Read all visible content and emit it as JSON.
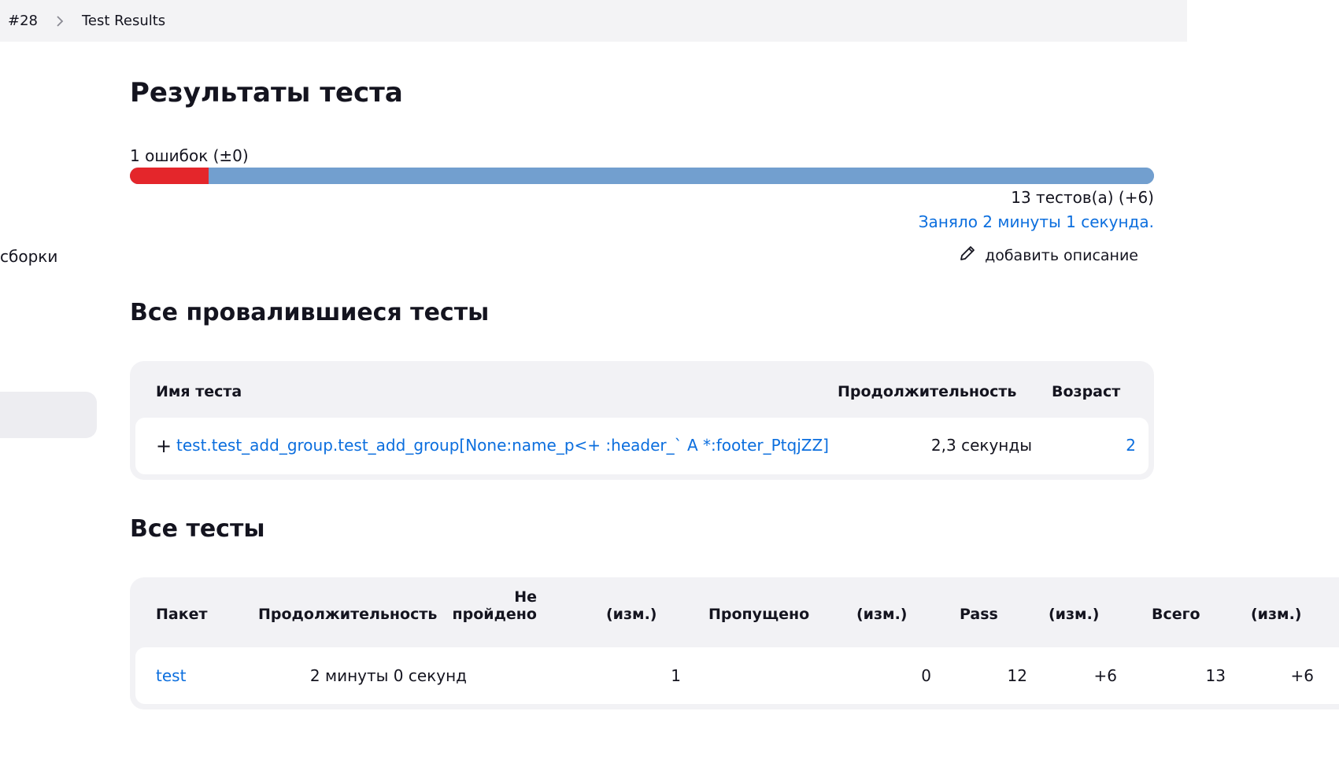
{
  "breadcrumb": {
    "build": "#28",
    "page": "Test Results"
  },
  "sidebar": {
    "partial_label": "сборки"
  },
  "main": {
    "title": "Результаты теста",
    "fail_summary": "1 ошибок (±0)",
    "progress": {
      "failed": 1,
      "total": 13,
      "fail_color": "#e4262b",
      "pass_color": "#729fcf"
    },
    "tests_count": "13 тестов(а) (+6)",
    "duration": "Заняло 2 минуты 1 секунда.",
    "add_description": "добавить описание"
  },
  "failed_section": {
    "title": "Все провалившиеся тесты",
    "columns": {
      "name": "Имя теста",
      "duration": "Продолжительность",
      "age": "Возраст"
    },
    "rows": [
      {
        "expand": "+",
        "name": "test.test_add_group.test_add_group[None:name_p<+ :header_` A *:footer_PtqjZZ]",
        "duration": "2,3 секунды",
        "age": "2"
      }
    ]
  },
  "all_section": {
    "title": "Все тесты",
    "columns": {
      "package": "Пакет",
      "duration": "Продолжительность",
      "failed_line1": "Не",
      "failed_line2": "пройдено",
      "failed_diff": "(изм.)",
      "skipped": "Пропущено",
      "skipped_diff": "(изм.)",
      "pass": "Pass",
      "pass_diff": "(изм.)",
      "total": "Всего",
      "total_diff": "(изм.)"
    },
    "rows": [
      {
        "package": "test",
        "duration": "2 минуты 0 секунд",
        "failed": "1",
        "failed_diff": "",
        "skipped": "0",
        "skipped_diff": "",
        "pass": "12",
        "pass_diff": "+6",
        "total": "13",
        "total_diff": "+6"
      }
    ]
  },
  "colors": {
    "link": "#0b6ede",
    "breadcrumb_bg": "#f3f3f5",
    "card_bg": "#f2f2f5"
  }
}
